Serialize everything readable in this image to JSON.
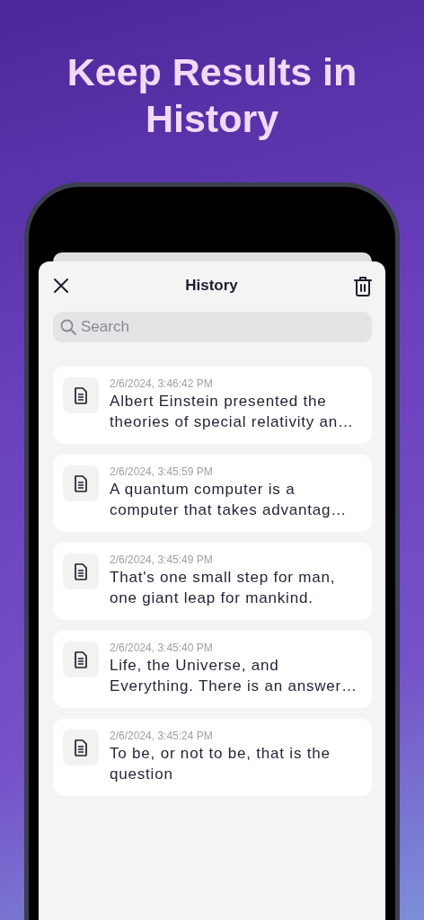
{
  "headline": "Keep Results in History",
  "sheet": {
    "title": "History",
    "search": {
      "placeholder": "Search"
    },
    "entries": [
      {
        "timestamp": "2/6/2024, 3:46:42 PM",
        "text": "Albert Einstein presented the theories of special relativity an…"
      },
      {
        "timestamp": "2/6/2024, 3:45:59 PM",
        "text": "A quantum computer is a computer that takes advantag…"
      },
      {
        "timestamp": "2/6/2024, 3:45:49 PM",
        "text": "That's one small step for man, one giant leap for mankind."
      },
      {
        "timestamp": "2/6/2024, 3:45:40 PM",
        "text": "Life, the Universe, and Everything. There is an answer…"
      },
      {
        "timestamp": "2/6/2024, 3:45:24 PM",
        "text": "To be, or not to be, that is the question"
      }
    ]
  }
}
